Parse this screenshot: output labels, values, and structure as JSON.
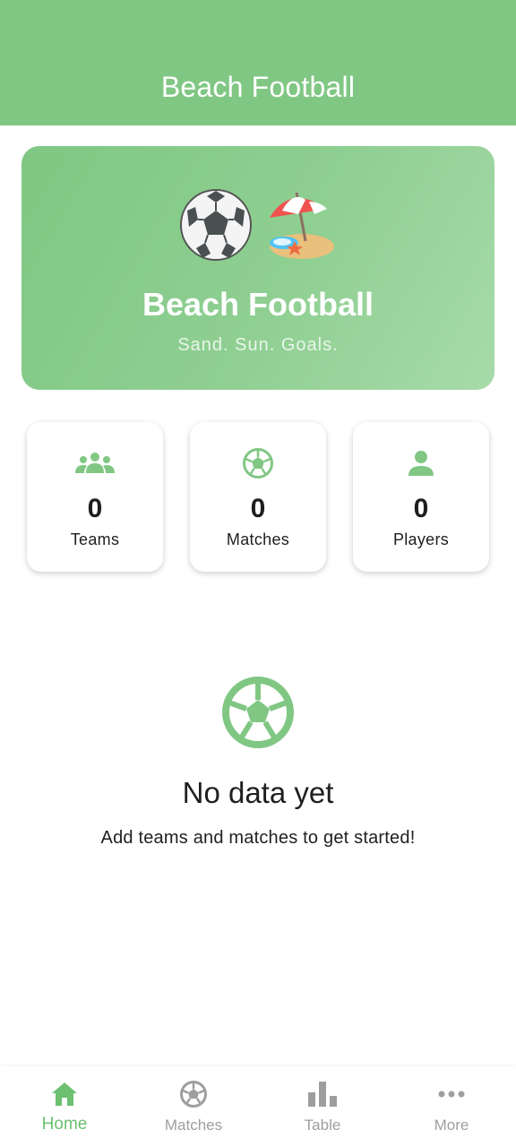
{
  "app_bar": {
    "title": "Beach Football"
  },
  "hero": {
    "icons": [
      "soccer-ball-emoji",
      "beach-umbrella-emoji"
    ],
    "title": "Beach Football",
    "subtitle": "Sand. Sun. Goals."
  },
  "stats": [
    {
      "icon": "group-icon",
      "value": "0",
      "label": "Teams"
    },
    {
      "icon": "soccer-ball-icon",
      "value": "0",
      "label": "Matches"
    },
    {
      "icon": "person-icon",
      "value": "0",
      "label": "Players"
    }
  ],
  "empty_state": {
    "icon": "soccer-ball-icon",
    "title": "No data yet",
    "message": "Add teams and matches to get started!"
  },
  "bottom_nav": {
    "items": [
      {
        "icon": "home-icon",
        "label": "Home",
        "active": true
      },
      {
        "icon": "soccer-ball-icon",
        "label": "Matches",
        "active": false
      },
      {
        "icon": "bar-chart-icon",
        "label": "Table",
        "active": false
      },
      {
        "icon": "more-horiz-icon",
        "label": "More",
        "active": false
      }
    ]
  },
  "colors": {
    "primary": "#81c784",
    "accent": "#6cc070",
    "inactive": "#9e9e9e"
  }
}
